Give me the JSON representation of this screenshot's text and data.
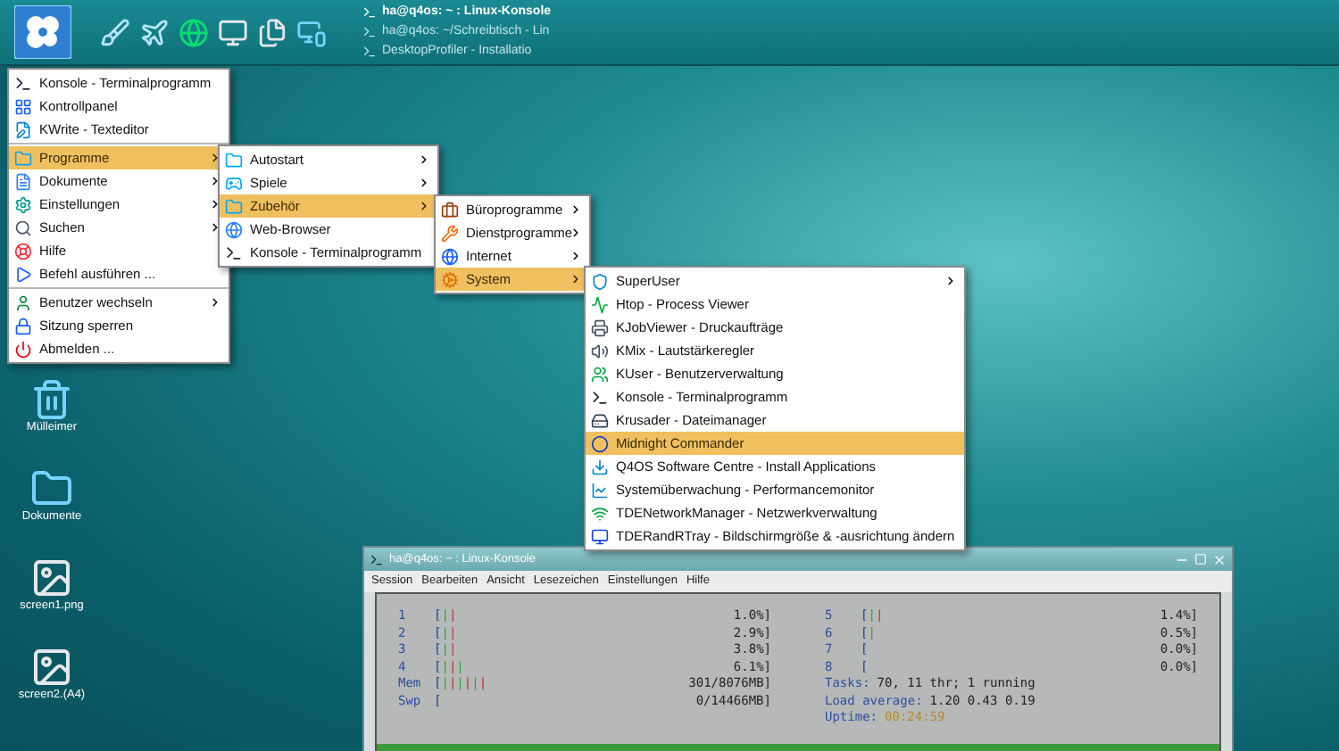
{
  "taskbar": {
    "tasks": [
      {
        "title": "ha@q4os: ~ : Linux-Konsole",
        "active": true
      },
      {
        "title": "ha@q4os: ~/Schreibtisch - Lin",
        "active": false
      },
      {
        "title": "DesktopProfiler - Installatio",
        "active": false
      }
    ]
  },
  "desktop_icons": [
    {
      "label": "Mülleimer"
    },
    {
      "label": "Dokumente"
    },
    {
      "label": "screen1.png"
    },
    {
      "label": "screen2.(A4)"
    }
  ],
  "main_menu": {
    "items": [
      {
        "kind": "item",
        "label": "Konsole - Terminalprogramm",
        "submenu": false,
        "selected": false
      },
      {
        "kind": "item",
        "label": "Kontrollpanel",
        "submenu": false,
        "selected": false
      },
      {
        "kind": "item",
        "label": "KWrite - Texteditor",
        "submenu": false,
        "selected": false
      },
      {
        "kind": "separator"
      },
      {
        "kind": "item",
        "label": "Programme",
        "submenu": true,
        "selected": true
      },
      {
        "kind": "item",
        "label": "Dokumente",
        "submenu": true,
        "selected": false
      },
      {
        "kind": "item",
        "label": "Einstellungen",
        "submenu": true,
        "selected": false
      },
      {
        "kind": "item",
        "label": "Suchen",
        "submenu": true,
        "selected": false
      },
      {
        "kind": "item",
        "label": "Hilfe",
        "submenu": false,
        "selected": false
      },
      {
        "kind": "item",
        "label": "Befehl ausführen ...",
        "submenu": false,
        "selected": false
      },
      {
        "kind": "separator"
      },
      {
        "kind": "item",
        "label": "Benutzer wechseln",
        "submenu": true,
        "selected": false
      },
      {
        "kind": "item",
        "label": "Sitzung sperren",
        "submenu": false,
        "selected": false
      },
      {
        "kind": "item",
        "label": "Abmelden ...",
        "submenu": false,
        "selected": false
      }
    ]
  },
  "programme_menu": {
    "items": [
      {
        "label": "Autostart",
        "submenu": true,
        "selected": false
      },
      {
        "label": "Spiele",
        "submenu": true,
        "selected": false
      },
      {
        "label": "Zubehör",
        "submenu": true,
        "selected": true
      },
      {
        "label": "Web-Browser",
        "submenu": false,
        "selected": false
      },
      {
        "label": "Konsole - Terminalprogramm",
        "submenu": false,
        "selected": false
      }
    ]
  },
  "zubehoer_menu": {
    "items": [
      {
        "label": "Büroprogramme",
        "submenu": true,
        "selected": false
      },
      {
        "label": "Dienstprogramme",
        "submenu": true,
        "selected": false
      },
      {
        "label": "Internet",
        "submenu": true,
        "selected": false
      },
      {
        "label": "System",
        "submenu": true,
        "selected": true
      }
    ]
  },
  "system_menu": {
    "items": [
      {
        "label": "SuperUser",
        "submenu": true,
        "selected": false
      },
      {
        "label": "Htop - Process Viewer",
        "submenu": false,
        "selected": false
      },
      {
        "label": "KJobViewer - Druckaufträge",
        "submenu": false,
        "selected": false
      },
      {
        "label": "KMix - Lautstärkeregler",
        "submenu": false,
        "selected": false
      },
      {
        "label": "KUser - Benutzerverwaltung",
        "submenu": false,
        "selected": false
      },
      {
        "label": "Konsole - Terminalprogramm",
        "submenu": false,
        "selected": false
      },
      {
        "label": "Krusader - Dateimanager",
        "submenu": false,
        "selected": false
      },
      {
        "label": "Midnight Commander",
        "submenu": false,
        "selected": true
      },
      {
        "label": "Q4OS Software Centre - Install Applications",
        "submenu": false,
        "selected": false
      },
      {
        "label": "Systemüberwachung - Performancemonitor",
        "submenu": false,
        "selected": false
      },
      {
        "label": "TDENetworkManager - Netzwerkverwaltung",
        "submenu": false,
        "selected": false
      },
      {
        "label": "TDERandRTray - Bildschirmgröße & -ausrichtung ändern",
        "submenu": false,
        "selected": false
      }
    ]
  },
  "terminal": {
    "title": "ha@q4os: ~ : Linux-Konsole",
    "menu": [
      "Session",
      "Bearbeiten",
      "Ansicht",
      "Lesezeichen",
      "Einstellungen",
      "Hilfe"
    ],
    "cpus_left": [
      {
        "label": "1",
        "bar": "[||",
        "reading": "1.0%]"
      },
      {
        "label": "2",
        "bar": "[||",
        "reading": "2.9%]"
      },
      {
        "label": "3",
        "bar": "[||",
        "reading": "3.8%]"
      },
      {
        "label": "4",
        "bar": "[|||",
        "reading": "6.1%]"
      }
    ],
    "cpus_right": [
      {
        "label": "5",
        "bar": "[||",
        "reading": "1.4%]"
      },
      {
        "label": "6",
        "bar": "[|",
        "reading": "0.5%]"
      },
      {
        "label": "7",
        "bar": "[",
        "reading": "0.0%]"
      },
      {
        "label": "8",
        "bar": "[",
        "reading": "0.0%]"
      }
    ],
    "memory": [
      {
        "label": "Mem",
        "bar": "[||||||",
        "reading": "301/8076MB]"
      },
      {
        "label": "Swp",
        "bar": "[",
        "reading": "0/14466MB]"
      }
    ],
    "stats": [
      {
        "key": "Tasks:",
        "value": "70, 11 thr; 1 running"
      },
      {
        "key": "Load average:",
        "value": "1.20 0.43 0.19"
      },
      {
        "key": "Uptime:",
        "value": "00:24:59"
      }
    ]
  }
}
